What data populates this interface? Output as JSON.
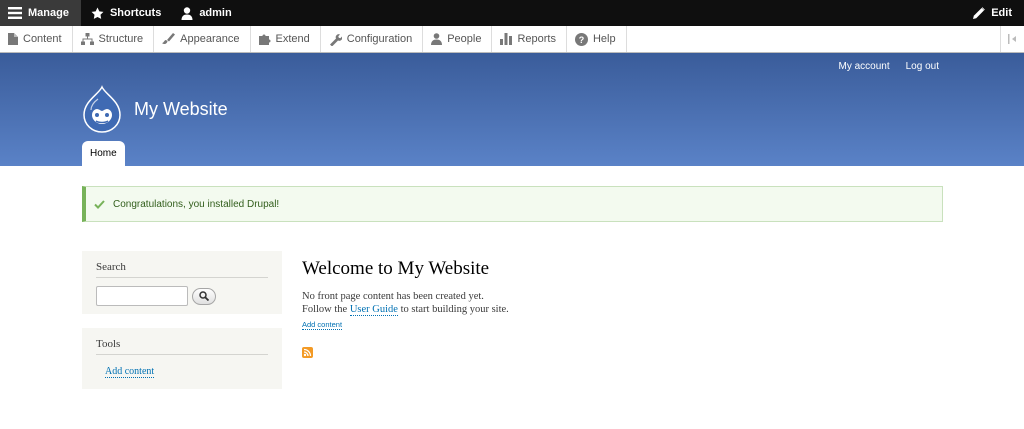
{
  "toolbar": {
    "manage": "Manage",
    "shortcuts": "Shortcuts",
    "user": "admin",
    "edit": "Edit"
  },
  "tray": {
    "items": [
      {
        "label": "Content",
        "icon": "document-icon"
      },
      {
        "label": "Structure",
        "icon": "structure-icon"
      },
      {
        "label": "Appearance",
        "icon": "brush-icon"
      },
      {
        "label": "Extend",
        "icon": "puzzle-icon"
      },
      {
        "label": "Configuration",
        "icon": "wrench-icon"
      },
      {
        "label": "People",
        "icon": "person-icon"
      },
      {
        "label": "Reports",
        "icon": "bar-chart-icon"
      },
      {
        "label": "Help",
        "icon": "help-icon"
      }
    ]
  },
  "header": {
    "site_name": "My Website",
    "secondary_nav": [
      "My account",
      "Log out"
    ],
    "primary_tab": "Home"
  },
  "message": {
    "text": "Congratulations, you installed Drupal!"
  },
  "sidebar": {
    "search_title": "Search",
    "search_placeholder": "",
    "tools_title": "Tools",
    "tools_link": "Add content"
  },
  "main": {
    "title": "Welcome to My Website",
    "line1": "No front page content has been created yet.",
    "line2_before": "Follow the ",
    "line2_link": "User Guide",
    "line2_after": " to start building your site.",
    "add_content": "Add content"
  },
  "colors": {
    "toolbar_bg": "#0f0f0f",
    "header_top": "#3a5c9a",
    "header_bottom": "#5a82c7",
    "link": "#0071b3",
    "message_border": "#77b259",
    "feed": "#f39a25"
  }
}
